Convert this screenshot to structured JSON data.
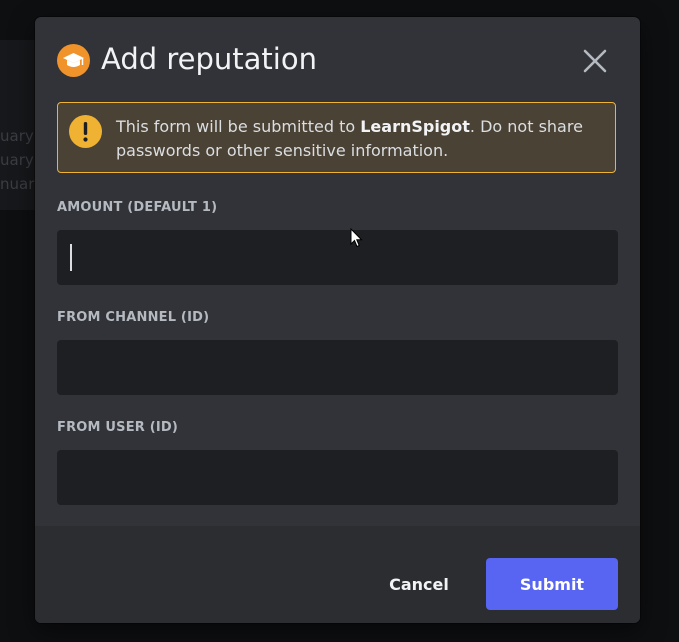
{
  "background": {
    "partial_lines": [
      "uary",
      "uary",
      "nuary"
    ]
  },
  "modal": {
    "header_icon": "graduation-cap-icon",
    "title": "Add reputation",
    "close_icon": "close-icon"
  },
  "notice": {
    "icon": "exclamation-icon",
    "text_before": "This form will be submitted to ",
    "app_name": "LearnSpigot",
    "text_after": ". Do not share passwords or other sensitive information."
  },
  "fields": [
    {
      "label": "AMOUNT (DEFAULT 1)",
      "value": "",
      "placeholder": ""
    },
    {
      "label": "FROM CHANNEL (ID)",
      "value": "",
      "placeholder": ""
    },
    {
      "label": "FROM USER (ID)",
      "value": "",
      "placeholder": ""
    }
  ],
  "footer": {
    "cancel_label": "Cancel",
    "submit_label": "Submit"
  },
  "colors": {
    "modal_bg": "#313338",
    "footer_bg": "#2b2d31",
    "input_bg": "#1e1f22",
    "accent": "#5865f2",
    "warning": "#f0b232",
    "header_icon_bg": "#f0932b"
  }
}
